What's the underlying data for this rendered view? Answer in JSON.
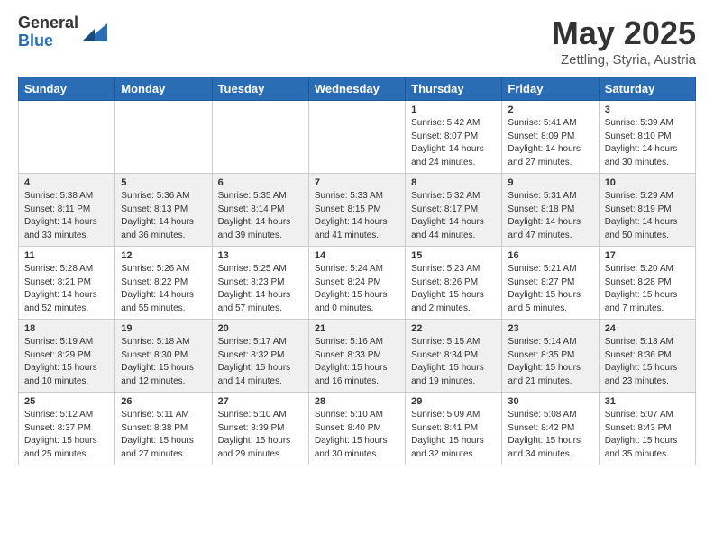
{
  "header": {
    "logo_general": "General",
    "logo_blue": "Blue",
    "month_year": "May 2025",
    "location": "Zettling, Styria, Austria"
  },
  "weekdays": [
    "Sunday",
    "Monday",
    "Tuesday",
    "Wednesday",
    "Thursday",
    "Friday",
    "Saturday"
  ],
  "rows": [
    [
      {
        "num": "",
        "info": ""
      },
      {
        "num": "",
        "info": ""
      },
      {
        "num": "",
        "info": ""
      },
      {
        "num": "",
        "info": ""
      },
      {
        "num": "1",
        "info": "Sunrise: 5:42 AM\nSunset: 8:07 PM\nDaylight: 14 hours\nand 24 minutes."
      },
      {
        "num": "2",
        "info": "Sunrise: 5:41 AM\nSunset: 8:09 PM\nDaylight: 14 hours\nand 27 minutes."
      },
      {
        "num": "3",
        "info": "Sunrise: 5:39 AM\nSunset: 8:10 PM\nDaylight: 14 hours\nand 30 minutes."
      }
    ],
    [
      {
        "num": "4",
        "info": "Sunrise: 5:38 AM\nSunset: 8:11 PM\nDaylight: 14 hours\nand 33 minutes."
      },
      {
        "num": "5",
        "info": "Sunrise: 5:36 AM\nSunset: 8:13 PM\nDaylight: 14 hours\nand 36 minutes."
      },
      {
        "num": "6",
        "info": "Sunrise: 5:35 AM\nSunset: 8:14 PM\nDaylight: 14 hours\nand 39 minutes."
      },
      {
        "num": "7",
        "info": "Sunrise: 5:33 AM\nSunset: 8:15 PM\nDaylight: 14 hours\nand 41 minutes."
      },
      {
        "num": "8",
        "info": "Sunrise: 5:32 AM\nSunset: 8:17 PM\nDaylight: 14 hours\nand 44 minutes."
      },
      {
        "num": "9",
        "info": "Sunrise: 5:31 AM\nSunset: 8:18 PM\nDaylight: 14 hours\nand 47 minutes."
      },
      {
        "num": "10",
        "info": "Sunrise: 5:29 AM\nSunset: 8:19 PM\nDaylight: 14 hours\nand 50 minutes."
      }
    ],
    [
      {
        "num": "11",
        "info": "Sunrise: 5:28 AM\nSunset: 8:21 PM\nDaylight: 14 hours\nand 52 minutes."
      },
      {
        "num": "12",
        "info": "Sunrise: 5:26 AM\nSunset: 8:22 PM\nDaylight: 14 hours\nand 55 minutes."
      },
      {
        "num": "13",
        "info": "Sunrise: 5:25 AM\nSunset: 8:23 PM\nDaylight: 14 hours\nand 57 minutes."
      },
      {
        "num": "14",
        "info": "Sunrise: 5:24 AM\nSunset: 8:24 PM\nDaylight: 15 hours\nand 0 minutes."
      },
      {
        "num": "15",
        "info": "Sunrise: 5:23 AM\nSunset: 8:26 PM\nDaylight: 15 hours\nand 2 minutes."
      },
      {
        "num": "16",
        "info": "Sunrise: 5:21 AM\nSunset: 8:27 PM\nDaylight: 15 hours\nand 5 minutes."
      },
      {
        "num": "17",
        "info": "Sunrise: 5:20 AM\nSunset: 8:28 PM\nDaylight: 15 hours\nand 7 minutes."
      }
    ],
    [
      {
        "num": "18",
        "info": "Sunrise: 5:19 AM\nSunset: 8:29 PM\nDaylight: 15 hours\nand 10 minutes."
      },
      {
        "num": "19",
        "info": "Sunrise: 5:18 AM\nSunset: 8:30 PM\nDaylight: 15 hours\nand 12 minutes."
      },
      {
        "num": "20",
        "info": "Sunrise: 5:17 AM\nSunset: 8:32 PM\nDaylight: 15 hours\nand 14 minutes."
      },
      {
        "num": "21",
        "info": "Sunrise: 5:16 AM\nSunset: 8:33 PM\nDaylight: 15 hours\nand 16 minutes."
      },
      {
        "num": "22",
        "info": "Sunrise: 5:15 AM\nSunset: 8:34 PM\nDaylight: 15 hours\nand 19 minutes."
      },
      {
        "num": "23",
        "info": "Sunrise: 5:14 AM\nSunset: 8:35 PM\nDaylight: 15 hours\nand 21 minutes."
      },
      {
        "num": "24",
        "info": "Sunrise: 5:13 AM\nSunset: 8:36 PM\nDaylight: 15 hours\nand 23 minutes."
      }
    ],
    [
      {
        "num": "25",
        "info": "Sunrise: 5:12 AM\nSunset: 8:37 PM\nDaylight: 15 hours\nand 25 minutes."
      },
      {
        "num": "26",
        "info": "Sunrise: 5:11 AM\nSunset: 8:38 PM\nDaylight: 15 hours\nand 27 minutes."
      },
      {
        "num": "27",
        "info": "Sunrise: 5:10 AM\nSunset: 8:39 PM\nDaylight: 15 hours\nand 29 minutes."
      },
      {
        "num": "28",
        "info": "Sunrise: 5:10 AM\nSunset: 8:40 PM\nDaylight: 15 hours\nand 30 minutes."
      },
      {
        "num": "29",
        "info": "Sunrise: 5:09 AM\nSunset: 8:41 PM\nDaylight: 15 hours\nand 32 minutes."
      },
      {
        "num": "30",
        "info": "Sunrise: 5:08 AM\nSunset: 8:42 PM\nDaylight: 15 hours\nand 34 minutes."
      },
      {
        "num": "31",
        "info": "Sunrise: 5:07 AM\nSunset: 8:43 PM\nDaylight: 15 hours\nand 35 minutes."
      }
    ]
  ]
}
